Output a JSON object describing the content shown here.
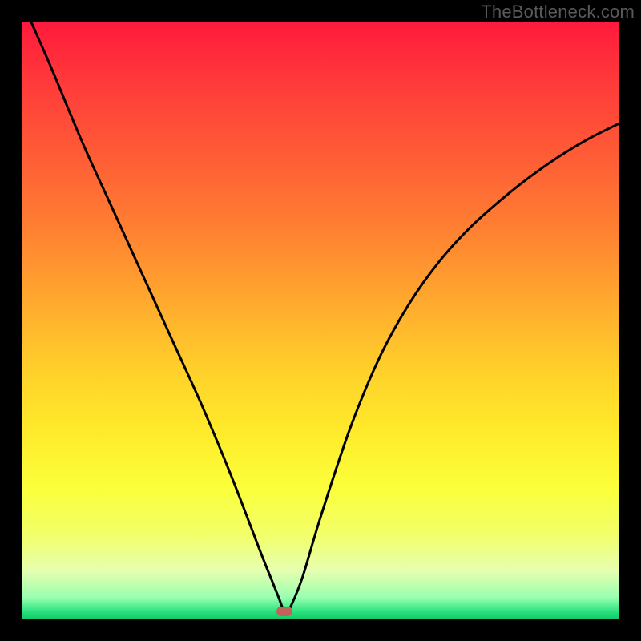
{
  "watermark": "TheBottleneck.com",
  "chart_data": {
    "type": "line",
    "title": "",
    "xlabel": "",
    "ylabel": "",
    "xlim": [
      0,
      100
    ],
    "ylim": [
      0,
      100
    ],
    "grid": false,
    "legend": false,
    "background_gradient": {
      "stops": [
        {
          "pos": 0.0,
          "color": "#ff1a3c"
        },
        {
          "pos": 0.1,
          "color": "#ff3a3a"
        },
        {
          "pos": 0.22,
          "color": "#ff5b36"
        },
        {
          "pos": 0.34,
          "color": "#ff7e32"
        },
        {
          "pos": 0.46,
          "color": "#ffa62e"
        },
        {
          "pos": 0.58,
          "color": "#ffcf2a"
        },
        {
          "pos": 0.68,
          "color": "#ffe92a"
        },
        {
          "pos": 0.78,
          "color": "#fbff3a"
        },
        {
          "pos": 0.86,
          "color": "#f2ff6a"
        },
        {
          "pos": 0.92,
          "color": "#e6ffb0"
        },
        {
          "pos": 0.965,
          "color": "#97ffb0"
        },
        {
          "pos": 0.99,
          "color": "#22e07a"
        },
        {
          "pos": 1.0,
          "color": "#18c96e"
        }
      ]
    },
    "series": [
      {
        "name": "bottleneck-curve",
        "color": "#000000",
        "stroke_width": 3,
        "x": [
          1.5,
          5,
          10,
          15,
          20,
          25,
          30,
          35,
          40,
          42,
          43,
          43.8,
          44.5,
          45,
          47,
          50,
          55,
          60,
          65,
          70,
          75,
          80,
          85,
          90,
          95,
          100
        ],
        "y": [
          100,
          92,
          80,
          69,
          58,
          47,
          36,
          24,
          11,
          6,
          3.5,
          1.5,
          1.5,
          2,
          7,
          17,
          32,
          44,
          53,
          60,
          65.5,
          70,
          74,
          77.5,
          80.5,
          83
        ]
      }
    ],
    "marker": {
      "x": 44,
      "y": 1.2,
      "color": "#c1635b"
    }
  }
}
